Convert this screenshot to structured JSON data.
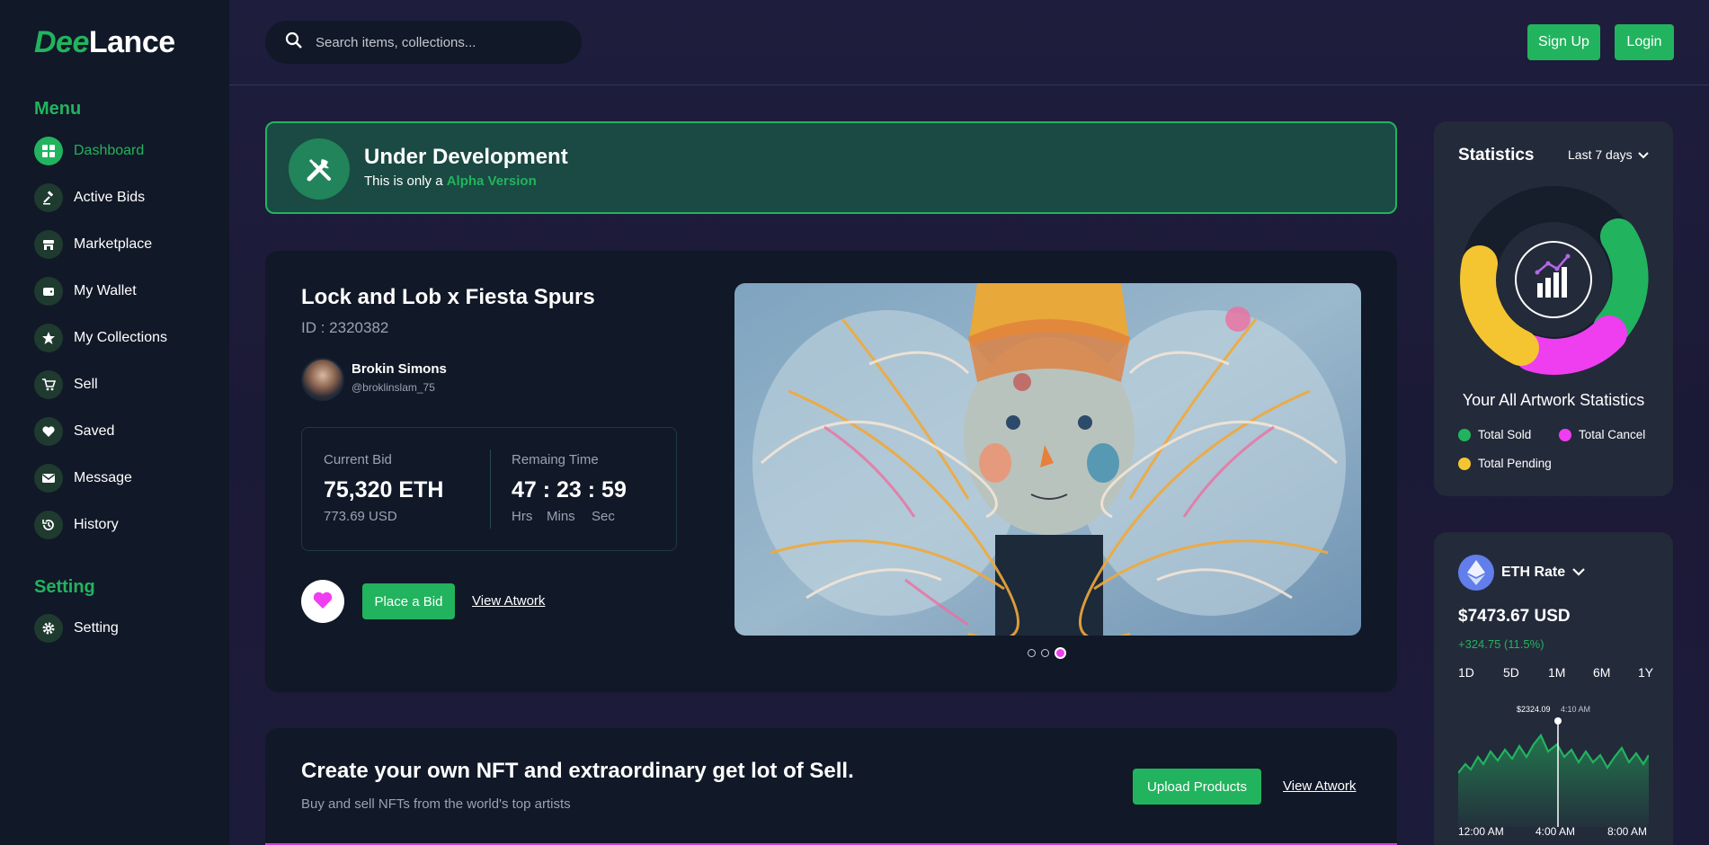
{
  "brand": {
    "part1": "Dee",
    "part2": "Lance"
  },
  "sidebar": {
    "menu_heading": "Menu",
    "items": [
      {
        "label": "Dashboard",
        "icon": "grid-icon",
        "active": true
      },
      {
        "label": "Active Bids",
        "icon": "gavel-icon"
      },
      {
        "label": "Marketplace",
        "icon": "store-icon"
      },
      {
        "label": "My Wallet",
        "icon": "wallet-icon"
      },
      {
        "label": "My Collections",
        "icon": "star-icon"
      },
      {
        "label": "Sell",
        "icon": "cart-icon"
      },
      {
        "label": "Saved",
        "icon": "heart-icon"
      },
      {
        "label": "Message",
        "icon": "mail-icon"
      },
      {
        "label": "History",
        "icon": "history-icon"
      }
    ],
    "setting_heading": "Setting",
    "setting_item": {
      "label": "Setting",
      "icon": "gear-icon"
    }
  },
  "header": {
    "search_placeholder": "Search items, collections...",
    "signup_label": "Sign Up",
    "login_label": "Login"
  },
  "banner": {
    "title": "Under Development",
    "sub_prefix": "This is only a ",
    "sub_highlight": "Alpha Version"
  },
  "feature": {
    "title": "Lock and Lob x Fiesta Spurs",
    "id": "ID : 2320382",
    "creator_name": "Brokin Simons",
    "creator_handle": "@broklinslam_75",
    "bid_label": "Current Bid",
    "bid_value": "75,320 ETH",
    "bid_usd": "773.69 USD",
    "time_label": "Remaing Time",
    "time_value": "47 : 23 : 59",
    "time_units": [
      "Hrs",
      "Mins",
      "Sec"
    ],
    "place_bid_label": "Place a Bid",
    "view_label": "View Atwork",
    "carousel_active": 3,
    "carousel_count": 3
  },
  "cta": {
    "title": "Create your own NFT and extraordinary get lot of Sell.",
    "sub": "Buy and sell NFTs from the world's top artists",
    "upload_label": "Upload Products",
    "view_label": "View Atwork"
  },
  "stats": {
    "title": "Statistics",
    "range": "Last 7 days",
    "subtitle": "Your All Artwork Statistics",
    "legend": [
      {
        "label": "Total Sold",
        "color": "#22b35e"
      },
      {
        "label": "Total Cancel",
        "color": "#ee3ef0"
      },
      {
        "label": "Total Pending",
        "color": "#f4c531"
      }
    ]
  },
  "eth": {
    "title": "ETH Rate",
    "price": "$7473.67 USD",
    "change": "+324.75 (11.5%)",
    "timeframes": [
      "1D",
      "5D",
      "1M",
      "6M",
      "1Y"
    ],
    "marker_price": "$2324.09",
    "marker_time": "4:10 AM",
    "x_ticks": [
      "12:00 AM",
      "4:00 AM",
      "8:00 AM"
    ]
  },
  "colors": {
    "accent": "#22b35e",
    "pink": "#ee3ef0",
    "yellow": "#f4c531",
    "card": "#111827"
  }
}
